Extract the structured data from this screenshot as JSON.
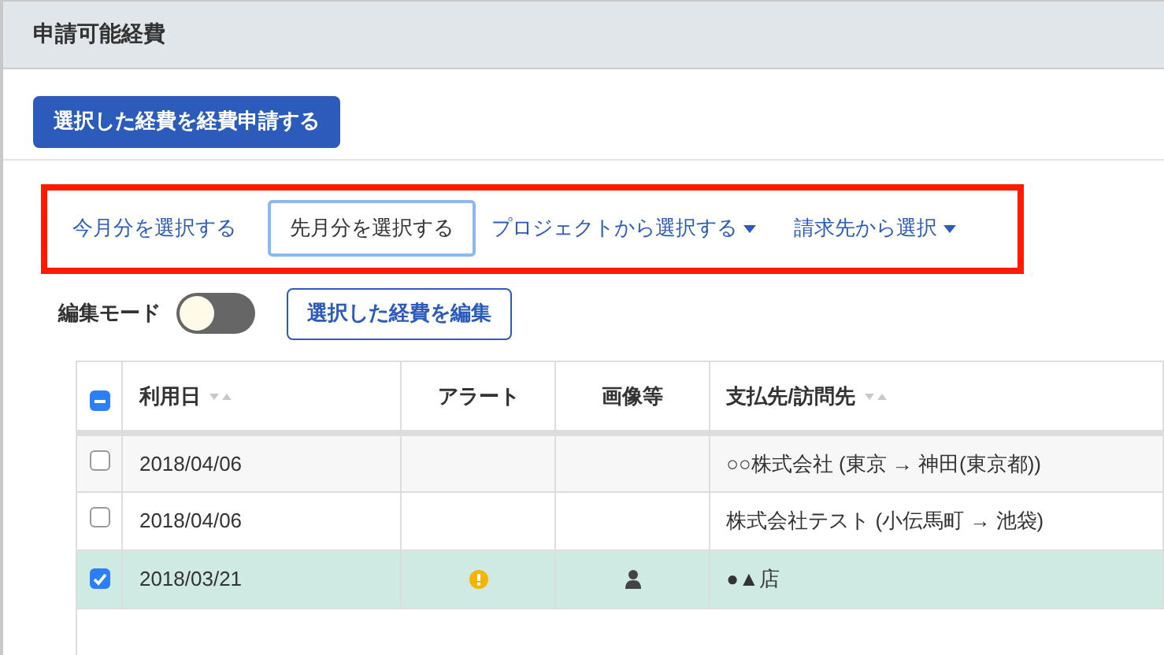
{
  "panel": {
    "title": "申請可能経費"
  },
  "apply_button": "選択した経費を経費申請する",
  "filters": [
    {
      "label": "今月分を選択する",
      "selected": false,
      "dropdown": false
    },
    {
      "label": "先月分を選択する",
      "selected": true,
      "dropdown": false
    },
    {
      "label": "プロジェクトから選択する",
      "selected": false,
      "dropdown": true
    },
    {
      "label": "請求先から選択",
      "selected": false,
      "dropdown": true
    }
  ],
  "edit_mode": {
    "label": "編集モード",
    "on": false
  },
  "edit_button": "選択した経費を編集",
  "table": {
    "select_all": {
      "indeterminate": true
    },
    "columns": [
      {
        "label": "利用日",
        "sortable": true
      },
      {
        "label": "アラート",
        "sortable": false
      },
      {
        "label": "画像等",
        "sortable": false
      },
      {
        "label": "支払先/訪問先",
        "sortable": true
      }
    ],
    "rows": [
      {
        "checked": false,
        "date": "2018/04/06",
        "alert": false,
        "image": false,
        "payee": "○○株式会社 (東京 → 神田(東京都))"
      },
      {
        "checked": false,
        "date": "2018/04/06",
        "alert": false,
        "image": false,
        "payee": "株式会社テスト (小伝馬町 → 池袋)"
      },
      {
        "checked": true,
        "date": "2018/03/21",
        "alert": true,
        "image": true,
        "payee": "●▲店"
      }
    ]
  }
}
